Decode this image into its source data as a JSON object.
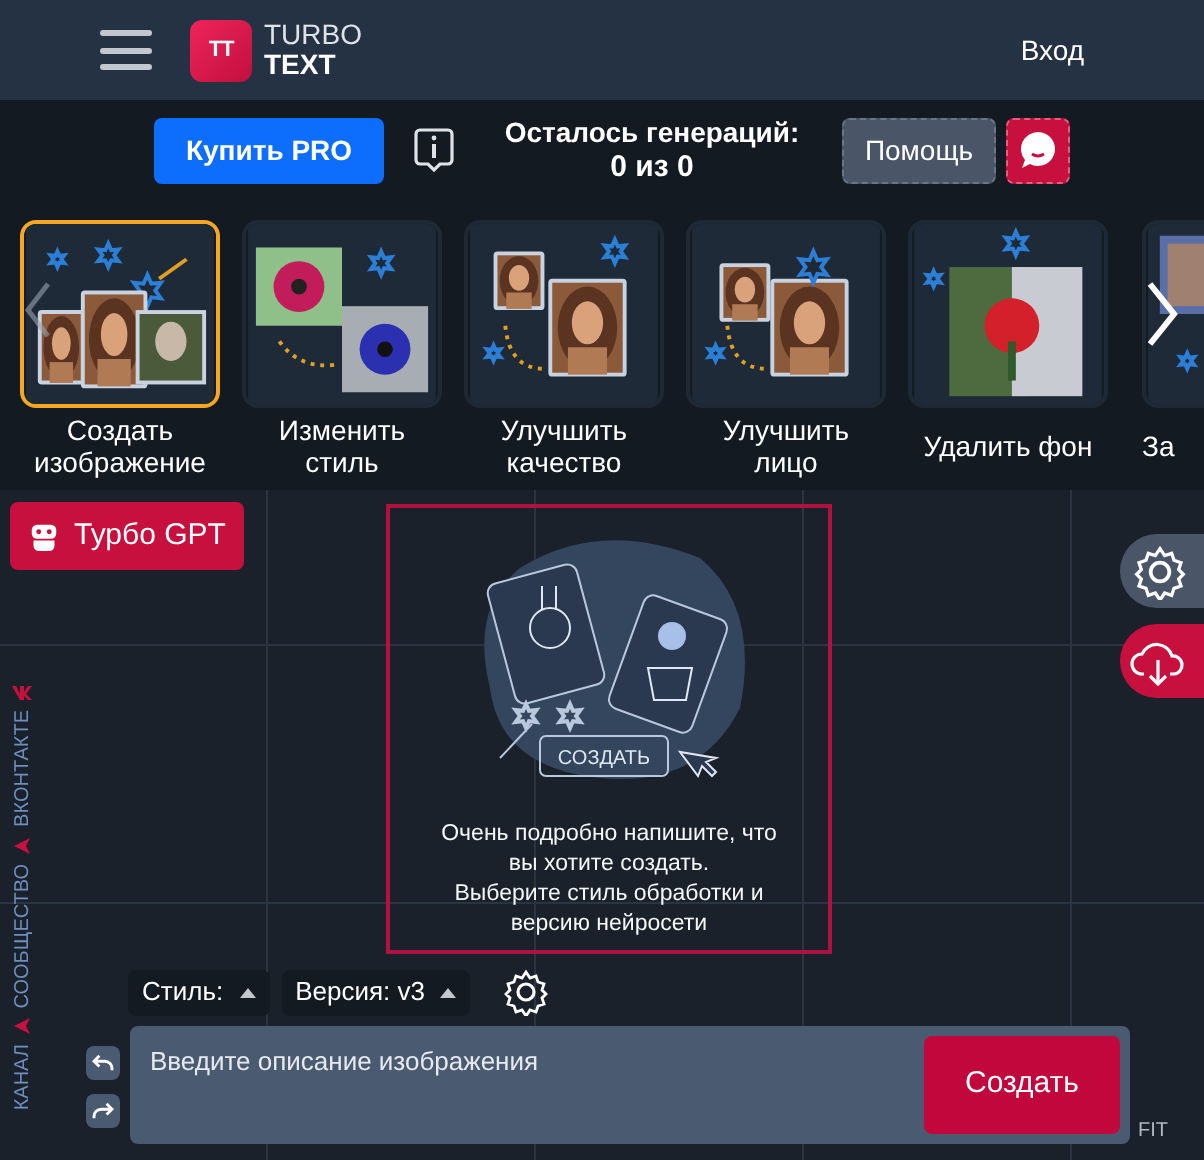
{
  "header": {
    "logo_mark": "TT",
    "logo_top": "TURBO",
    "logo_bottom": "TEXT",
    "login": "Вход"
  },
  "toolbar": {
    "buy_button": "Купить PRO",
    "remaining_label": "Осталось генераций:",
    "remaining_value": "0 из 0",
    "help_button": "Помощь"
  },
  "tools": [
    {
      "label": "Создать изображение",
      "selected": true
    },
    {
      "label": "Изменить стиль",
      "selected": false
    },
    {
      "label": "Улучшить качество",
      "selected": false
    },
    {
      "label": "Улучшить лицо",
      "selected": false
    },
    {
      "label": "Удалить фон",
      "selected": false
    },
    {
      "label": "За",
      "selected": false
    }
  ],
  "gpt_button": "Турбо GPT",
  "side_links": [
    {
      "text": "КАНАЛ",
      "kind": "telegram"
    },
    {
      "text": "СООБЩЕСТВО",
      "kind": "telegram"
    },
    {
      "text": "ВКОНТАКТЕ",
      "kind": "vk"
    }
  ],
  "empty_state": {
    "illustration_button": "СОЗДАТЬ",
    "lines": [
      "Очень подробно напишите, что",
      "вы хотите создать.",
      "Выберите стиль обработки и",
      "версию нейросети"
    ]
  },
  "style_select": "Стиль:",
  "version_select": "Версия: v3",
  "prompt": {
    "placeholder": "Введите описание изображения"
  },
  "create_button": "Создать",
  "fit_label": "FIT"
}
